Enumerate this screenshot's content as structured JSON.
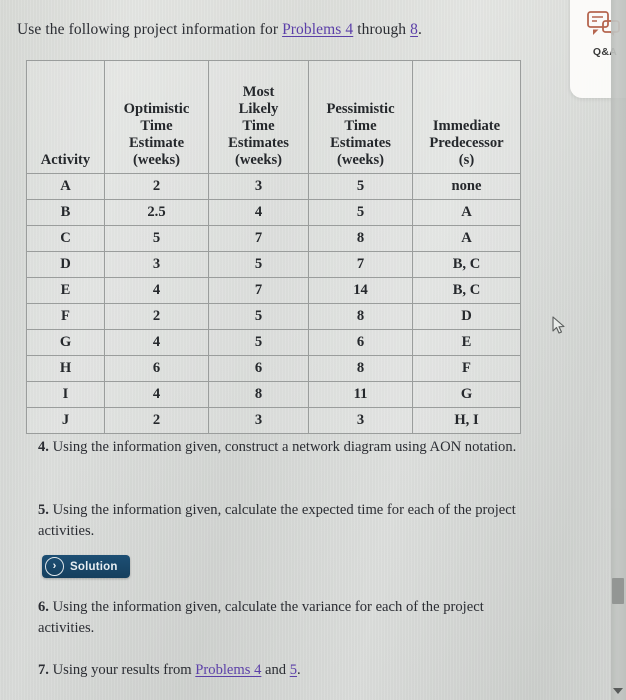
{
  "intro": {
    "before": "Use the following project information for ",
    "link1": "Problems 4",
    "middle": " through ",
    "link2": "8",
    "after": "."
  },
  "table": {
    "headers": [
      "Activity",
      "Optimistic Time Estimate (weeks)",
      "Most Likely Time Estimates (weeks)",
      "Pessimistic Time Estimates (weeks)",
      "Immediate Predecessor (s)"
    ],
    "header_lines": [
      [
        "Activity"
      ],
      [
        "Optimistic",
        "Time",
        "Estimate",
        "(weeks)"
      ],
      [
        "Most",
        "Likely",
        "Time",
        "Estimates",
        "(weeks)"
      ],
      [
        "Pessimistic",
        "Time",
        "Estimates",
        "(weeks)"
      ],
      [
        "Immediate",
        "Predecessor",
        "(s)"
      ]
    ],
    "rows": [
      {
        "activity": "A",
        "optimistic": "2",
        "most_likely": "3",
        "pessimistic": "5",
        "predecessors": "none"
      },
      {
        "activity": "B",
        "optimistic": "2.5",
        "most_likely": "4",
        "pessimistic": "5",
        "predecessors": "A"
      },
      {
        "activity": "C",
        "optimistic": "5",
        "most_likely": "7",
        "pessimistic": "8",
        "predecessors": "A"
      },
      {
        "activity": "D",
        "optimistic": "3",
        "most_likely": "5",
        "pessimistic": "7",
        "predecessors": "B, C"
      },
      {
        "activity": "E",
        "optimistic": "4",
        "most_likely": "7",
        "pessimistic": "14",
        "predecessors": "B, C"
      },
      {
        "activity": "F",
        "optimistic": "2",
        "most_likely": "5",
        "pessimistic": "8",
        "predecessors": "D"
      },
      {
        "activity": "G",
        "optimistic": "4",
        "most_likely": "5",
        "pessimistic": "6",
        "predecessors": "E"
      },
      {
        "activity": "H",
        "optimistic": "6",
        "most_likely": "6",
        "pessimistic": "8",
        "predecessors": "F"
      },
      {
        "activity": "I",
        "optimistic": "4",
        "most_likely": "8",
        "pessimistic": "11",
        "predecessors": "G"
      },
      {
        "activity": "J",
        "optimistic": "2",
        "most_likely": "3",
        "pessimistic": "3",
        "predecessors": "H, I"
      }
    ]
  },
  "problems": {
    "p4": {
      "number": "4.",
      "text": " Using the information given, construct a network diagram using AON notation."
    },
    "p5": {
      "number": "5.",
      "text": " Using the information given, calculate the expected time for each of the project activities."
    },
    "p6": {
      "number": "6.",
      "text": " Using the information given, calculate the variance for each of the project activities."
    },
    "p7": {
      "number": "7.",
      "before": " Using your results from ",
      "link": "Problems 4",
      "middle": " and ",
      "link2": "5",
      "after": "."
    }
  },
  "solution_button": {
    "chevron": "›",
    "label": "Solution"
  },
  "qa_panel": {
    "label": "Q&A",
    "icon": "chat-bubble-icon"
  },
  "colors": {
    "link": "#5b3fa8",
    "solution_bg": "#17456a",
    "qa_icon": "#b5654f",
    "table_border": "#9a9d9c"
  }
}
